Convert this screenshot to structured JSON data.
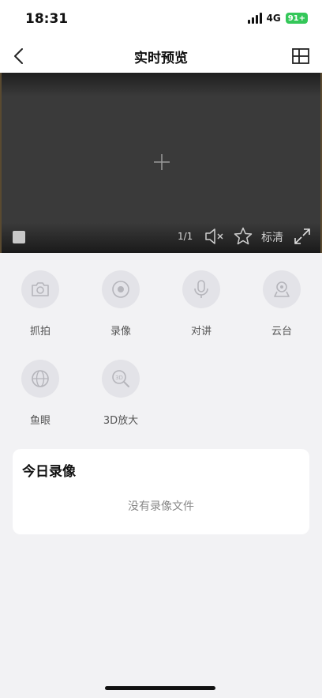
{
  "status": {
    "time": "18:31",
    "network": "4G",
    "battery": "91+"
  },
  "nav": {
    "title": "实时预览"
  },
  "player": {
    "page_indicator": "1/1",
    "quality_label": "标清"
  },
  "functions": [
    {
      "label": "抓拍",
      "icon": "camera-icon"
    },
    {
      "label": "录像",
      "icon": "record-icon"
    },
    {
      "label": "对讲",
      "icon": "microphone-icon"
    },
    {
      "label": "云台",
      "icon": "ptz-icon"
    },
    {
      "label": "鱼眼",
      "icon": "fisheye-icon"
    },
    {
      "label": "3D放大",
      "icon": "zoom-3d-icon"
    }
  ],
  "recordings": {
    "title": "今日录像",
    "empty_text": "没有录像文件"
  },
  "colors": {
    "accent_battery": "#34c759",
    "icon_gray": "#b5b5bb",
    "card_bg": "#ffffff",
    "page_bg": "#f2f2f4"
  }
}
